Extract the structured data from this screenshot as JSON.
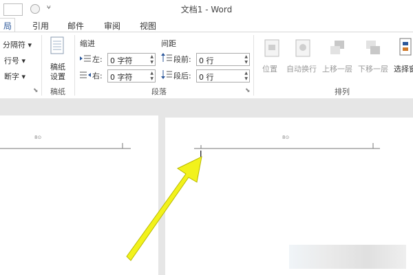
{
  "window": {
    "title": "文档1 - Word"
  },
  "tabs": [
    {
      "label": "局",
      "active": true
    },
    {
      "label": "引用"
    },
    {
      "label": "邮件"
    },
    {
      "label": "审阅"
    },
    {
      "label": "视图"
    }
  ],
  "ribbon": {
    "left_items": [
      "分隔符 ▾",
      "行号 ▾",
      "断字 ▾"
    ],
    "manuscript": {
      "button_line1": "稿纸",
      "button_line2": "设置",
      "group_label": "稿纸"
    },
    "paragraph": {
      "indent_title": "缩进",
      "spacing_title": "间距",
      "left_label": "左:",
      "right_label": "右:",
      "before_label": "段前:",
      "after_label": "段后:",
      "left_value": "0 字符",
      "right_value": "0 字符",
      "before_value": "0 行",
      "after_value": "0 行",
      "group_label": "段落"
    },
    "arrange": {
      "position": "位置",
      "wrap_text": "自动换行",
      "bring_forward": "上移一层",
      "send_backward": "下移一层",
      "selection_pane": "选择窗",
      "group_label": "排列"
    }
  },
  "document": {
    "header_mark_left": "8⊙",
    "header_mark_right": "8⊙",
    "cursor": "I"
  },
  "colors": {
    "accent": "#2b579a",
    "arrow": "#f2f21c",
    "arrow_outline": "#b8b800"
  }
}
